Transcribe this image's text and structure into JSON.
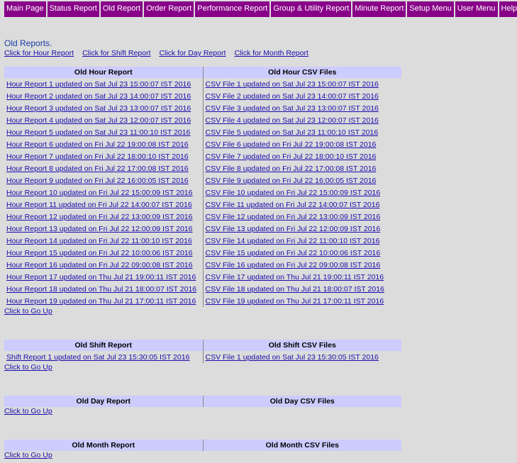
{
  "nav": [
    "Main Page",
    "Status Report",
    "Old Report",
    "Order Report",
    "Performance Report",
    "Group & Utility Report",
    "Minute Report",
    "Setup Menu",
    "User Menu",
    "Help"
  ],
  "heading": "Old Reports.",
  "quick_links": [
    "Click for Hour Report",
    "Click for Shift Report",
    "Click for Day Report",
    "Click for Month Report"
  ],
  "go_up": "Click to Go Up",
  "hour": {
    "head_report": "Old Hour Report",
    "head_csv": "Old Hour CSV Files",
    "rows": [
      [
        "Hour Report 1 updated on Sat Jul 23 15:00:07 IST 2016",
        "CSV File 1 updated on Sat Jul 23 15:00:07 IST 2016"
      ],
      [
        "Hour Report 2 updated on Sat Jul 23 14:00:07 IST 2016",
        "CSV File 2 updated on Sat Jul 23 14:00:07 IST 2016"
      ],
      [
        "Hour Report 3 updated on Sat Jul 23 13:00:07 IST 2016",
        "CSV File 3 updated on Sat Jul 23 13:00:07 IST 2016"
      ],
      [
        "Hour Report 4 updated on Sat Jul 23 12:00:07 IST 2016",
        "CSV File 4 updated on Sat Jul 23 12:00:07 IST 2016"
      ],
      [
        "Hour Report 5 updated on Sat Jul 23 11:00:10 IST 2016",
        "CSV File 5 updated on Sat Jul 23 11:00:10 IST 2016"
      ],
      [
        "Hour Report 6 updated on Fri Jul 22 19:00:08 IST 2016",
        "CSV File 6 updated on Fri Jul 22 19:00:08 IST 2016"
      ],
      [
        "Hour Report 7 updated on Fri Jul 22 18:00:10 IST 2016",
        "CSV File 7 updated on Fri Jul 22 18:00:10 IST 2016"
      ],
      [
        "Hour Report 8 updated on Fri Jul 22 17:00:08 IST 2016",
        "CSV File 8 updated on Fri Jul 22 17:00:08 IST 2016"
      ],
      [
        "Hour Report 9 updated on Fri Jul 22 16:00:05 IST 2016",
        "CSV File 9 updated on Fri Jul 22 16:00:05 IST 2016"
      ],
      [
        "Hour Report 10 updated on Fri Jul 22 15:00:09 IST 2016",
        "CSV File 10 updated on Fri Jul 22 15:00:09 IST 2016"
      ],
      [
        "Hour Report 11 updated on Fri Jul 22 14:00:07 IST 2016",
        "CSV File 11 updated on Fri Jul 22 14:00:07 IST 2016"
      ],
      [
        "Hour Report 12 updated on Fri Jul 22 13:00:09 IST 2016",
        "CSV File 12 updated on Fri Jul 22 13:00:09 IST 2016"
      ],
      [
        "Hour Report 13 updated on Fri Jul 22 12:00:09 IST 2016",
        "CSV File 13 updated on Fri Jul 22 12:00:09 IST 2016"
      ],
      [
        "Hour Report 14 updated on Fri Jul 22 11:00:10 IST 2016",
        "CSV File 14 updated on Fri Jul 22 11:00:10 IST 2016"
      ],
      [
        "Hour Report 15 updated on Fri Jul 22 10:00:06 IST 2016",
        "CSV File 15 updated on Fri Jul 22 10:00:06 IST 2016"
      ],
      [
        "Hour Report 16 updated on Fri Jul 22 09:00:08 IST 2016",
        "CSV File 16 updated on Fri Jul 22 09:00:08 IST 2016"
      ],
      [
        "Hour Report 17 updated on Thu Jul 21 19:00:11 IST 2016",
        "CSV File 17 updated on Thu Jul 21 19:00:11 IST 2016"
      ],
      [
        "Hour Report 18 updated on Thu Jul 21 18:00:07 IST 2016",
        "CSV File 18 updated on Thu Jul 21 18:00:07 IST 2016"
      ],
      [
        "Hour Report 19 updated on Thu Jul 21 17:00:11 IST 2016",
        "CSV File 19 updated on Thu Jul 21 17:00:11 IST 2016"
      ]
    ]
  },
  "shift": {
    "head_report": "Old Shift Report",
    "head_csv": "Old Shift CSV Files",
    "rows": [
      [
        "Shift Report 1 updated on Sat Jul 23 15:30:05 IST 2016",
        "CSV File 1 updated on Sat Jul 23 15:30:05 IST 2016"
      ]
    ]
  },
  "day": {
    "head_report": "Old Day Report",
    "head_csv": "Old Day CSV Files",
    "rows": []
  },
  "month": {
    "head_report": "Old Month Report",
    "head_csv": "Old Month CSV Files",
    "rows": []
  }
}
